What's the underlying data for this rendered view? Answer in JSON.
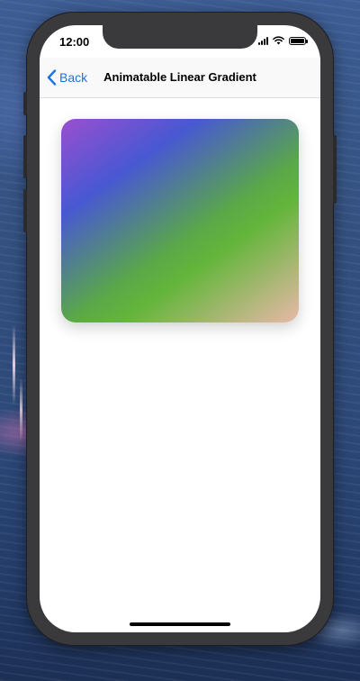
{
  "status_bar": {
    "time": "12:00",
    "battery_level": 1.0
  },
  "navigation": {
    "back_label": "Back",
    "title": "Animatable Linear Gradient"
  },
  "gradient_card": {
    "colors": [
      "#9a4fd0",
      "#4858d2",
      "#63b53a",
      "#e8b8a8"
    ]
  },
  "accent_color": "#1a73e8"
}
